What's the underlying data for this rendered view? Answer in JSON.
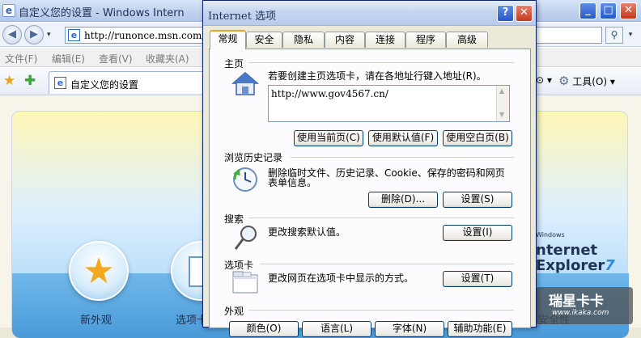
{
  "ie": {
    "window_title": "自定义您的设置 - Windows Intern",
    "address": "http://runonce.msn.com/ru",
    "menu": [
      "文件(F)",
      "编辑(E)",
      "查看(V)",
      "收藏夹(A)"
    ],
    "tab_title": "自定义您的设置",
    "cmd_page": "⊙ ▾",
    "cmd_tools": "工具(O) ▾",
    "content": {
      "logo_windows": "Windows",
      "logo_line1": "nternet",
      "logo_line2": "Explorer",
      "logo_seven": "7",
      "label_appearance": "新外观",
      "label_tabs": "选项卡",
      "label_security": "安全性"
    },
    "watermark": {
      "line1": "瑞星卡卡",
      "line2": "www.ikaka.com"
    }
  },
  "dialog": {
    "title": "Internet 选项",
    "tabs": [
      "常规",
      "安全",
      "隐私",
      "内容",
      "连接",
      "程序",
      "高级"
    ],
    "active_tab": "常规",
    "home": {
      "heading": "主页",
      "desc": "若要创建主页选项卡，请在各地址行键入地址(R)。",
      "url": "http://www.gov4567.cn/",
      "btn_current": "使用当前页(C)",
      "btn_default": "使用默认值(F)",
      "btn_blank": "使用空白页(B)"
    },
    "history": {
      "heading": "浏览历史记录",
      "desc_line1": "删除临时文件、历史记录、Cookie、保存的密码和网页",
      "desc_line2": "表单信息。",
      "btn_delete": "删除(D)...",
      "btn_settings": "设置(S)"
    },
    "search": {
      "heading": "搜索",
      "desc": "更改搜索默认值。",
      "btn_settings": "设置(I)"
    },
    "tabs_section": {
      "heading": "选项卡",
      "desc": "更改网页在选项卡中显示的方式。",
      "btn_settings": "设置(T)"
    },
    "appearance": {
      "heading": "外观",
      "btn_colors": "颜色(O)",
      "btn_languages": "语言(L)",
      "btn_fonts": "字体(N)",
      "btn_accessibility": "辅助功能(E)"
    }
  }
}
